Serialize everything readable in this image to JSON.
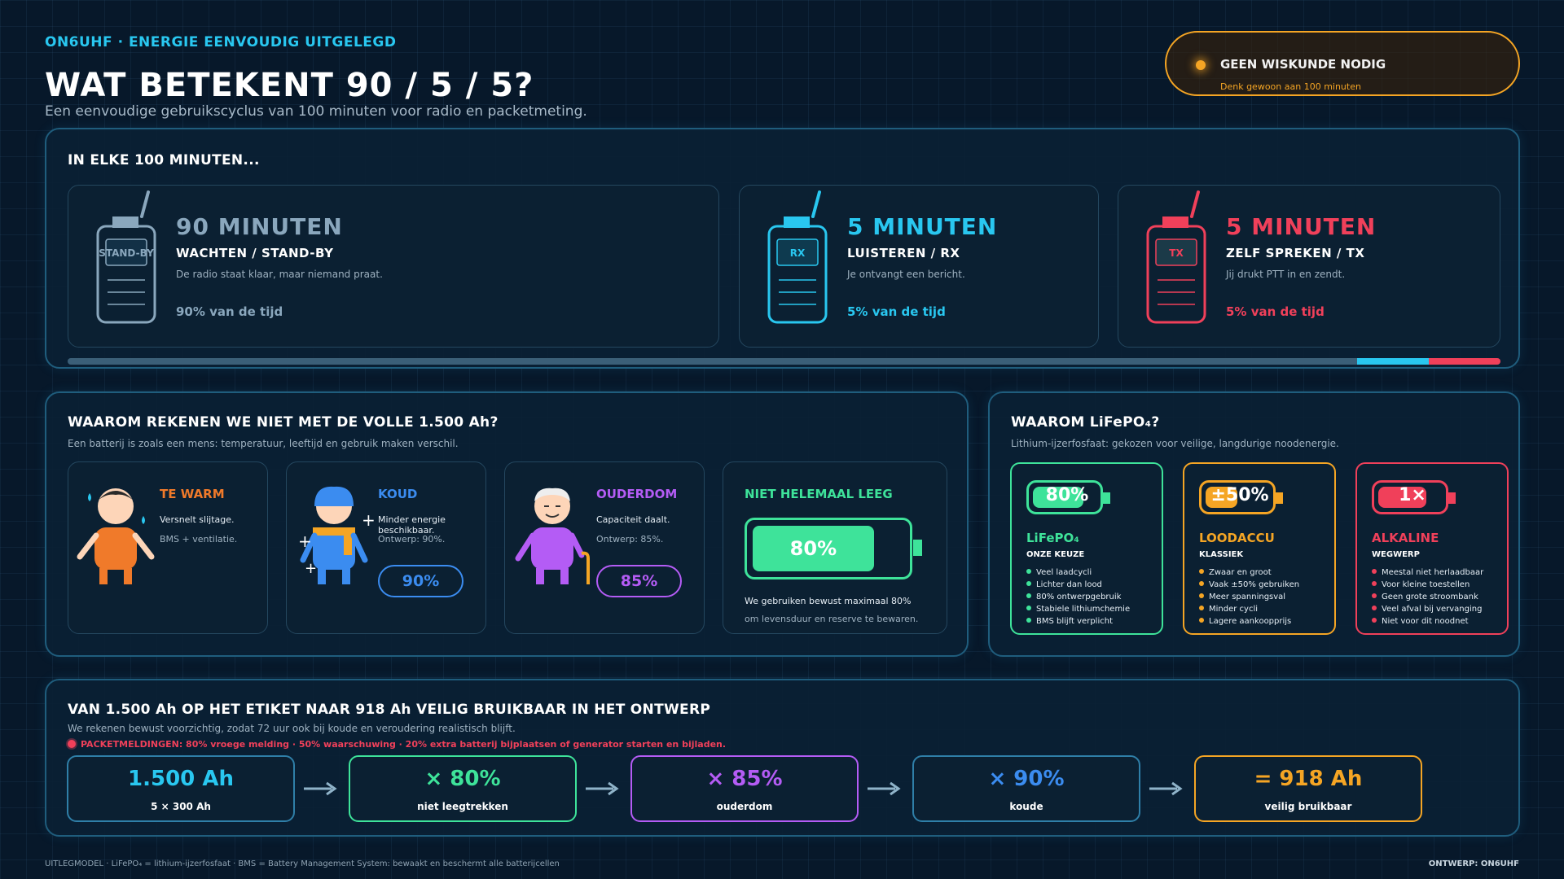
{
  "header": {
    "brand": "ON6UHF · ENERGIE EENVOUDIG UITGELEGD",
    "title": "WAT BETEKENT 90 / 5 / 5?",
    "subtitle": "Een eenvoudige gebruikscyclus van 100 minuten voor radio en packetmeting."
  },
  "badge": {
    "title": "GEEN WISKUNDE NODIG",
    "subtitle": "Denk gewoon aan 100 minuten"
  },
  "cycle": {
    "title": "IN ELKE 100 MINUTEN...",
    "modes": [
      {
        "screen": "STAND-BY",
        "minutes": "90 MINUTEN",
        "label": "WACHTEN / STAND-BY",
        "desc": "De radio staat klaar, maar niemand praat.",
        "share": "90% van de tijd",
        "color": "#8aa7bd",
        "fraction": 0.9
      },
      {
        "screen": "RX",
        "minutes": "5 MINUTEN",
        "label": "LUISTEREN / RX",
        "desc": "Je ontvangt een bericht.",
        "share": "5% van de tijd",
        "color": "#29c7f0",
        "fraction": 0.05
      },
      {
        "screen": "TX",
        "minutes": "5 MINUTEN",
        "label": "ZELF SPREKEN / TX",
        "desc": "Jij drukt PTT in en zendt.",
        "share": "5% van de tijd",
        "color": "#f0405a",
        "fraction": 0.05
      }
    ]
  },
  "derating": {
    "title": "WAAROM REKENEN WE NIET MET DE VOLLE 1.500 Ah?",
    "subtitle": "Een batterij is zoals een mens: temperatuur, leeftijd en gebruik maken verschil.",
    "cards": [
      {
        "title": "TE WARM",
        "desc": "Versnelt slijtage.",
        "sub": "BMS + ventilatie.",
        "color": "#f07a2a"
      },
      {
        "title": "KOUD",
        "desc": "Minder energie beschikbaar.",
        "sub": "Ontwerp: 90%.",
        "badge": "90%",
        "color": "#3b8cf0"
      },
      {
        "title": "OUDERDOM",
        "desc": "Capaciteit daalt.",
        "sub": "Ontwerp: 85%.",
        "badge": "85%",
        "color": "#b45cf5"
      },
      {
        "title": "NIET HELEMAAL LEEG",
        "battery": "80%",
        "desc": "We gebruiken bewust maximaal 80%",
        "sub": "om levensduur en reserve te bewaren.",
        "color": "#3ee39a",
        "fraction": 0.8
      }
    ]
  },
  "chemistry": {
    "title": "WAAROM LiFePO₄?",
    "subtitle": "Lithium-ijzerfosfaat: gekozen voor veilige, langdurige noodenergie.",
    "types": [
      {
        "badge": "80%",
        "name": "LiFePO₄",
        "tag": "ONZE KEUZE",
        "color": "#3ee39a",
        "fraction": 0.8,
        "points": [
          "Veel laadcycli",
          "Lichter dan lood",
          "80% ontwerpgebruik",
          "Stabiele lithiumchemie",
          "BMS blijft verplicht"
        ]
      },
      {
        "badge": "±50%",
        "name": "LOODACCU",
        "tag": "KLASSIEK",
        "color": "#f5a524",
        "fraction": 0.5,
        "points": [
          "Zwaar en groot",
          "Vaak ±50% gebruiken",
          "Meer spanningsval",
          "Minder cycli",
          "Lagere aankoopprijs"
        ]
      },
      {
        "badge": "1×",
        "name": "ALKALINE",
        "tag": "WEGWERP",
        "color": "#f0405a",
        "fraction": 0.75,
        "points": [
          "Meestal niet herlaadbaar",
          "Voor kleine toestellen",
          "Geen grote stroombank",
          "Veel afval bij vervanging",
          "Niet voor dit noodnet"
        ]
      }
    ]
  },
  "calc": {
    "title": "VAN 1.500 Ah OP HET ETIKET NAAR 918 Ah VEILIG BRUIKBAAR IN HET ONTWERP",
    "subtitle": "We rekenen bewust voorzichtig, zodat 72 uur ook bij koude en veroudering realistisch blijft.",
    "alert": "PACKETMELDINGEN: 80% vroege melding · 50% waarschuwing · 20% extra batterij bijplaatsen of generator starten en bijladen.",
    "steps": [
      {
        "value": "1.500 Ah",
        "label": "5 × 300 Ah",
        "color": "#29c7f0",
        "border": "#2f7fa8"
      },
      {
        "value": "× 80%",
        "label": "niet leegtrekken",
        "color": "#3ee39a",
        "border": "#3ee39a"
      },
      {
        "value": "× 85%",
        "label": "ouderdom",
        "color": "#b45cf5",
        "border": "#b45cf5"
      },
      {
        "value": "× 90%",
        "label": "koude",
        "color": "#3b8cf0",
        "border": "#2f7fa8"
      },
      {
        "value": "= 918 Ah",
        "label": "veilig bruikbaar",
        "color": "#f5a524",
        "border": "#f5a524"
      }
    ]
  },
  "footer": {
    "left": "UITLEGMODEL · LiFePO₄ = lithium-ijzerfosfaat · BMS = Battery Management System: bewaakt en beschermt alle batterijcellen",
    "right": "ONTWERP: ON6UHF"
  }
}
